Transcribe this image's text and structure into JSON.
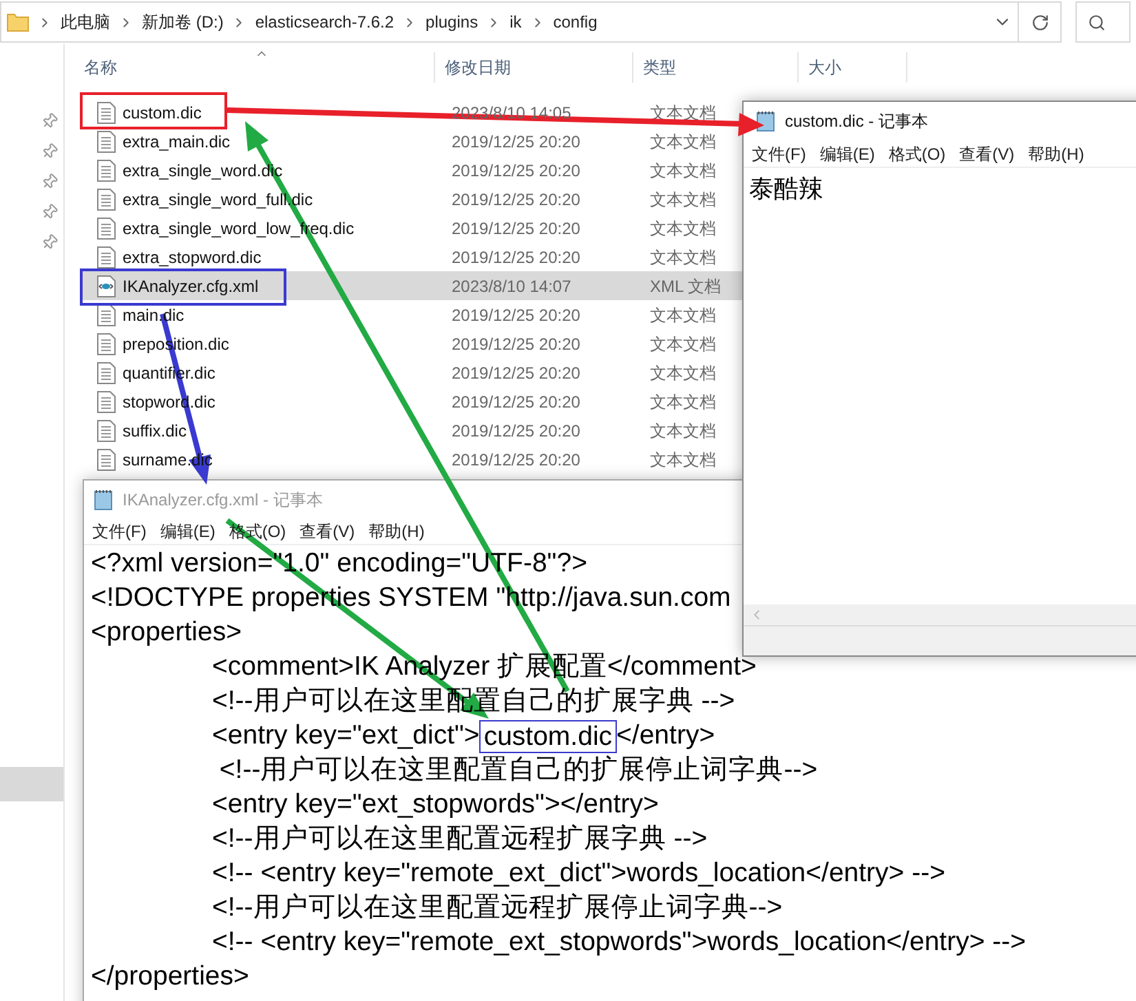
{
  "explorer": {
    "breadcrumbs": [
      "此电脑",
      "新加卷 (D:)",
      "elasticsearch-7.6.2",
      "plugins",
      "ik",
      "config"
    ],
    "columns": [
      "名称",
      "修改日期",
      "类型",
      "大小"
    ],
    "files": [
      {
        "name": "custom.dic",
        "date": "2023/8/10 14:05",
        "type": "文本文档",
        "kind": "text",
        "selected": false
      },
      {
        "name": "extra_main.dic",
        "date": "2019/12/25 20:20",
        "type": "文本文档",
        "kind": "text",
        "selected": false
      },
      {
        "name": "extra_single_word.dic",
        "date": "2019/12/25 20:20",
        "type": "文本文档",
        "kind": "text",
        "selected": false
      },
      {
        "name": "extra_single_word_full.dic",
        "date": "2019/12/25 20:20",
        "type": "文本文档",
        "kind": "text",
        "selected": false
      },
      {
        "name": "extra_single_word_low_freq.dic",
        "date": "2019/12/25 20:20",
        "type": "文本文档",
        "kind": "text",
        "selected": false
      },
      {
        "name": "extra_stopword.dic",
        "date": "2019/12/25 20:20",
        "type": "文本文档",
        "kind": "text",
        "selected": false
      },
      {
        "name": "IKAnalyzer.cfg.xml",
        "date": "2023/8/10 14:07",
        "type": "XML 文档",
        "kind": "xml",
        "selected": true
      },
      {
        "name": "main.dic",
        "date": "2019/12/25 20:20",
        "type": "文本文档",
        "kind": "text",
        "selected": false
      },
      {
        "name": "preposition.dic",
        "date": "2019/12/25 20:20",
        "type": "文本文档",
        "kind": "text",
        "selected": false
      },
      {
        "name": "quantifier.dic",
        "date": "2019/12/25 20:20",
        "type": "文本文档",
        "kind": "text",
        "selected": false
      },
      {
        "name": "stopword.dic",
        "date": "2019/12/25 20:20",
        "type": "文本文档",
        "kind": "text",
        "selected": false
      },
      {
        "name": "suffix.dic",
        "date": "2019/12/25 20:20",
        "type": "文本文档",
        "kind": "text",
        "selected": false
      },
      {
        "name": "surname.dic",
        "date": "2019/12/25 20:20",
        "type": "文本文档",
        "kind": "text",
        "selected": false
      }
    ]
  },
  "xml_notepad": {
    "title": "IKAnalyzer.cfg.xml - 记事本",
    "active": false,
    "menu": [
      "文件(F)",
      "编辑(E)",
      "格式(O)",
      "查看(V)",
      "帮助(H)"
    ],
    "lines": [
      {
        "text": "<?xml version=\"1.0\" encoding=\"UTF-8\"?>",
        "indented": false
      },
      {
        "text": "<!DOCTYPE properties SYSTEM \"http://java.sun.com",
        "indented": false
      },
      {
        "text": "<properties>",
        "indented": false
      },
      {
        "text": "<comment>IK Analyzer 扩展配置</comment>",
        "indented": true
      },
      {
        "text": "<!--用户可以在这里配置自己的扩展字典 -->",
        "indented": true
      },
      {
        "text": "<entry key=\"ext_dict\">",
        "boxed": "custom.dic",
        "after": "</entry>",
        "indented": true
      },
      {
        "text": " <!--用户可以在这里配置自己的扩展停止词字典-->",
        "indented": true
      },
      {
        "text": "<entry key=\"ext_stopwords\"></entry>",
        "indented": true
      },
      {
        "text": "<!--用户可以在这里配置远程扩展字典 -->",
        "indented": true
      },
      {
        "text": "<!-- <entry key=\"remote_ext_dict\">words_location</entry> -->",
        "indented": true
      },
      {
        "text": "<!--用户可以在这里配置远程扩展停止词字典-->",
        "indented": true
      },
      {
        "text": "<!-- <entry key=\"remote_ext_stopwords\">words_location</entry> -->",
        "indented": true
      },
      {
        "text": "</properties>",
        "indented": false
      }
    ]
  },
  "dic_notepad": {
    "title": "custom.dic - 记事本",
    "active": true,
    "menu": [
      "文件(F)",
      "编辑(E)",
      "格式(O)",
      "查看(V)",
      "帮助(H)"
    ],
    "content": "泰酷辣"
  }
}
